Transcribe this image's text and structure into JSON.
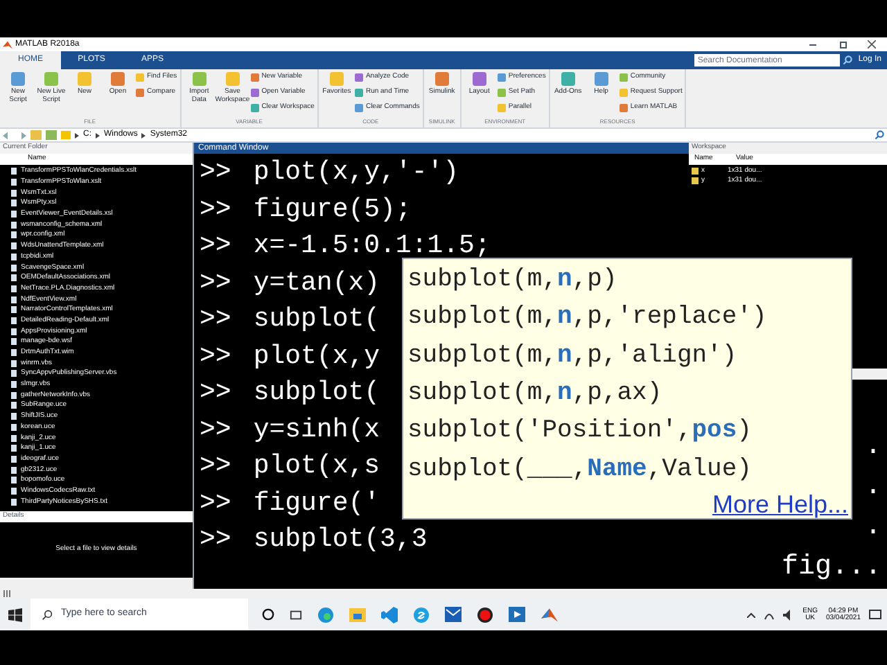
{
  "window": {
    "title": "MATLAB R2018a"
  },
  "tabs": [
    {
      "label": "HOME",
      "selected": true
    },
    {
      "label": "PLOTS",
      "selected": false
    },
    {
      "label": "APPS",
      "selected": false
    }
  ],
  "search": {
    "placeholder": "Search Documentation"
  },
  "login": "Log In",
  "toolstrip": [
    {
      "label": "FILE",
      "large": [
        "New Script",
        "New Live Script",
        "New",
        "Open"
      ],
      "small": [
        "Find Files",
        "Compare"
      ]
    },
    {
      "label": "VARIABLE",
      "large": [
        "Import Data",
        "Save Workspace"
      ],
      "small": [
        "New Variable",
        "Open Variable",
        "Clear Workspace"
      ]
    },
    {
      "label": "CODE",
      "large": [
        "Favorites"
      ],
      "small": [
        "Analyze Code",
        "Run and Time",
        "Clear Commands"
      ]
    },
    {
      "label": "SIMULINK",
      "large": [
        "Simulink"
      ]
    },
    {
      "label": "ENVIRONMENT",
      "large": [
        "Layout"
      ],
      "small": [
        "Preferences",
        "Set Path",
        "Parallel"
      ]
    },
    {
      "label": "RESOURCES",
      "large": [
        "Add-Ons",
        "Help"
      ],
      "small": [
        "Community",
        "Request Support",
        "Learn MATLAB"
      ]
    }
  ],
  "path": [
    "C:",
    "Windows",
    "System32"
  ],
  "current_folder": {
    "title": "Current Folder",
    "column": "Name",
    "files": [
      "TransformPPSToWlanCredentials.xslt",
      "TransformPPSToWlan.xslt",
      "WsmTxt.xsl",
      "WsmPty.xsl",
      "EventViewer_EventDetails.xsl",
      "wsmanconfig_schema.xml",
      "wpr.config.xml",
      "WdsUnattendTemplate.xml",
      "tcpbidi.xml",
      "ScavengeSpace.xml",
      "OEMDefaultAssociations.xml",
      "NetTrace.PLA.Diagnostics.xml",
      "NdfEventView.xml",
      "NarratorControlTemplates.xml",
      "DetailedReading-Default.xml",
      "AppsProvisioning.xml",
      "manage-bde.wsf",
      "DrtmAuthTxt.wim",
      "winrm.vbs",
      "SyncAppvPublishingServer.vbs",
      "slmgr.vbs",
      "gatherNetworkInfo.vbs",
      "SubRange.uce",
      "ShiftJIS.uce",
      "korean.uce",
      "kanji_2.uce",
      "kanji_1.uce",
      "ideograf.uce",
      "gb2312.uce",
      "bopomofo.uce",
      "WindowsCodecsRaw.txt",
      "ThirdPartyNoticesBySHS.txt"
    ]
  },
  "details": {
    "title": "Details",
    "message": "Select a file to view details"
  },
  "command_window": {
    "title": "Command Window",
    "lines": [
      {
        "prompt": ">>",
        "code": "plot(x,y,'-')"
      },
      {
        "prompt": ">>",
        "code": "figure(5);"
      },
      {
        "prompt": ">>",
        "code": "x=-1.5:0.1:1.5;"
      },
      {
        "prompt": ">>",
        "code": "y=tan(x)"
      },
      {
        "prompt": ">>",
        "code": "subplot("
      },
      {
        "prompt": ">>",
        "code": "plot(x,y"
      },
      {
        "prompt": ">>",
        "code": "subplot("
      },
      {
        "prompt": ">>",
        "code": "y=sinh(x"
      },
      {
        "prompt": ">>",
        "code": "plot(x,s"
      },
      {
        "prompt": ">>",
        "code": "figure('"
      },
      {
        "prompt": ">>",
        "code": "subplot(3,3"
      }
    ]
  },
  "hint_popup": {
    "signatures": [
      "subplot(m,**n**,p)",
      "subplot(m,**n**,p,'replace')",
      "subplot(m,**n**,p,'align')",
      "subplot(m,**n**,p,ax)",
      "subplot('Position',**pos**)",
      "subplot(___,**Name**,Value)"
    ],
    "link": "More Help..."
  },
  "workspace": {
    "title": "Workspace",
    "columns": [
      "Name",
      "Value"
    ],
    "rows": [
      {
        "name": "x",
        "value": "1x31 dou..."
      },
      {
        "name": "y",
        "value": "1x31 dou..."
      }
    ]
  },
  "second_window": {
    "lines": [
      ".",
      ".",
      ".",
      "fig..."
    ]
  },
  "taskbar": {
    "search_placeholder": "Type here to search",
    "language": "ENG",
    "region": "UK",
    "time": "04:29 PM",
    "date": "03/04/2021"
  }
}
